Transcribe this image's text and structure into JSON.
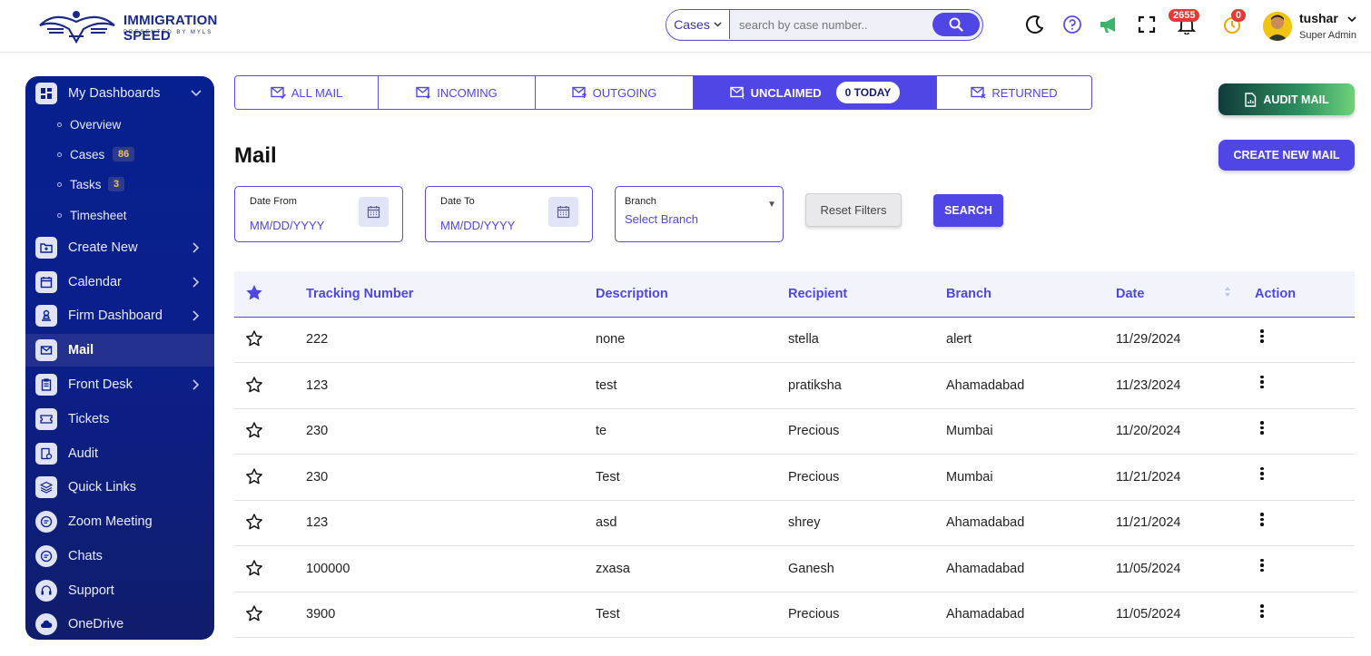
{
  "brand": {
    "name": "IMMIGRATION SPEED",
    "tagline": "PRESENTED BY MYLS"
  },
  "search": {
    "scope": "Cases",
    "placeholder": "search by case number.."
  },
  "header": {
    "notification_count": "2655",
    "timer_count": "0",
    "user_name": "tushar",
    "user_role": "Super Admin"
  },
  "sidebar": {
    "dashboards": "My Dashboards",
    "sub": [
      {
        "label": "Overview",
        "count": ""
      },
      {
        "label": "Cases",
        "count": "86"
      },
      {
        "label": "Tasks",
        "count": "3"
      },
      {
        "label": "Timesheet",
        "count": ""
      }
    ],
    "items": [
      {
        "label": "Create New"
      },
      {
        "label": "Calendar"
      },
      {
        "label": "Firm Dashboard"
      },
      {
        "label": "Mail"
      },
      {
        "label": "Front Desk"
      },
      {
        "label": "Tickets"
      },
      {
        "label": "Audit"
      },
      {
        "label": "Quick Links"
      },
      {
        "label": "Zoom Meeting"
      },
      {
        "label": "Chats"
      },
      {
        "label": "Support"
      },
      {
        "label": "OneDrive"
      }
    ]
  },
  "tabs": [
    {
      "label": "ALL MAIL"
    },
    {
      "label": "INCOMING"
    },
    {
      "label": "OUTGOING"
    },
    {
      "label": "UNCLAIMED",
      "pill": "0 TODAY"
    },
    {
      "label": "RETURNED"
    }
  ],
  "actions": {
    "audit_mail": "AUDIT MAIL",
    "create_new_mail": "CREATE NEW MAIL"
  },
  "page": {
    "title": "Mail"
  },
  "filters": {
    "date_from_label": "Date From",
    "date_from_value": "MM/DD/YYYY",
    "date_to_label": "Date To",
    "date_to_value": "MM/DD/YYYY",
    "branch_label": "Branch",
    "branch_value": "Select Branch",
    "reset": "Reset Filters",
    "search": "SEARCH"
  },
  "table": {
    "columns": [
      "Tracking Number",
      "Description",
      "Recipient",
      "Branch",
      "Date",
      "Action"
    ],
    "rows": [
      {
        "tracking": "222",
        "description": "none",
        "recipient": "stella",
        "branch": "alert",
        "date": "11/29/2024"
      },
      {
        "tracking": "123",
        "description": "test",
        "recipient": "pratiksha",
        "branch": "Ahamadabad",
        "date": "11/23/2024"
      },
      {
        "tracking": "230",
        "description": "te",
        "recipient": "Precious",
        "branch": "Mumbai",
        "date": "11/20/2024"
      },
      {
        "tracking": "230",
        "description": "Test",
        "recipient": "Precious",
        "branch": "Mumbai",
        "date": "11/21/2024"
      },
      {
        "tracking": "123",
        "description": "asd",
        "recipient": "shrey",
        "branch": "Ahamadabad",
        "date": "11/21/2024"
      },
      {
        "tracking": "100000",
        "description": "zxasa",
        "recipient": "Ganesh",
        "branch": "Ahamadabad",
        "date": "11/05/2024"
      },
      {
        "tracking": "3900",
        "description": "Test",
        "recipient": "Precious",
        "branch": "Ahamadabad",
        "date": "11/05/2024"
      }
    ]
  },
  "colors": {
    "accent": "#4f46e5",
    "sidebar": "#0b1f8a",
    "badge": "#e53935"
  }
}
